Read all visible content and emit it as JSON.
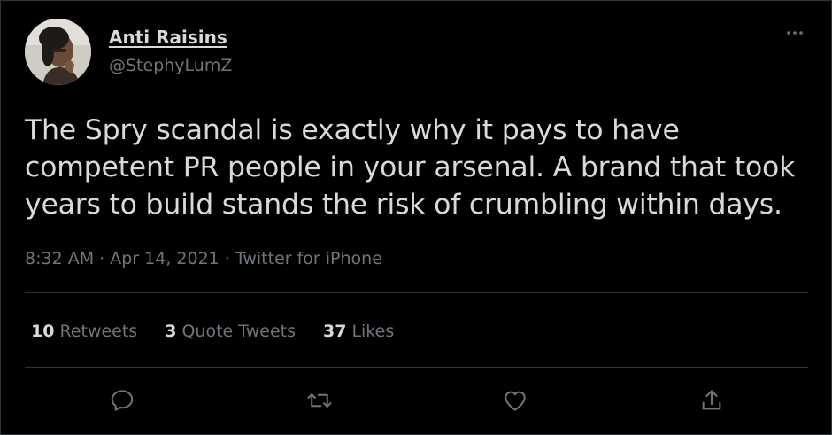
{
  "tweet": {
    "author_name": "Anti Raisins",
    "author_handle": "@StephyLumZ",
    "text": "The Spry scandal is exactly why it pays to have competent PR people in your arsenal. A brand that took years to build stands the risk of crumbling within days.",
    "time": "8:32 AM",
    "date": "Apr 14, 2021",
    "source": "Twitter for iPhone",
    "separator": " · "
  },
  "stats": {
    "retweets_count": "10",
    "retweets_label": "Retweets",
    "quote_count": "3",
    "quote_label": "Quote Tweets",
    "likes_count": "37",
    "likes_label": "Likes"
  },
  "icons": {
    "more": "more-horizontal-icon",
    "reply": "reply-icon",
    "retweet": "retweet-icon",
    "like": "like-heart-icon",
    "share": "share-icon"
  },
  "colors": {
    "background": "#000000",
    "text": "#d9d9d9",
    "muted": "#6e767d",
    "border": "#2f3336"
  }
}
